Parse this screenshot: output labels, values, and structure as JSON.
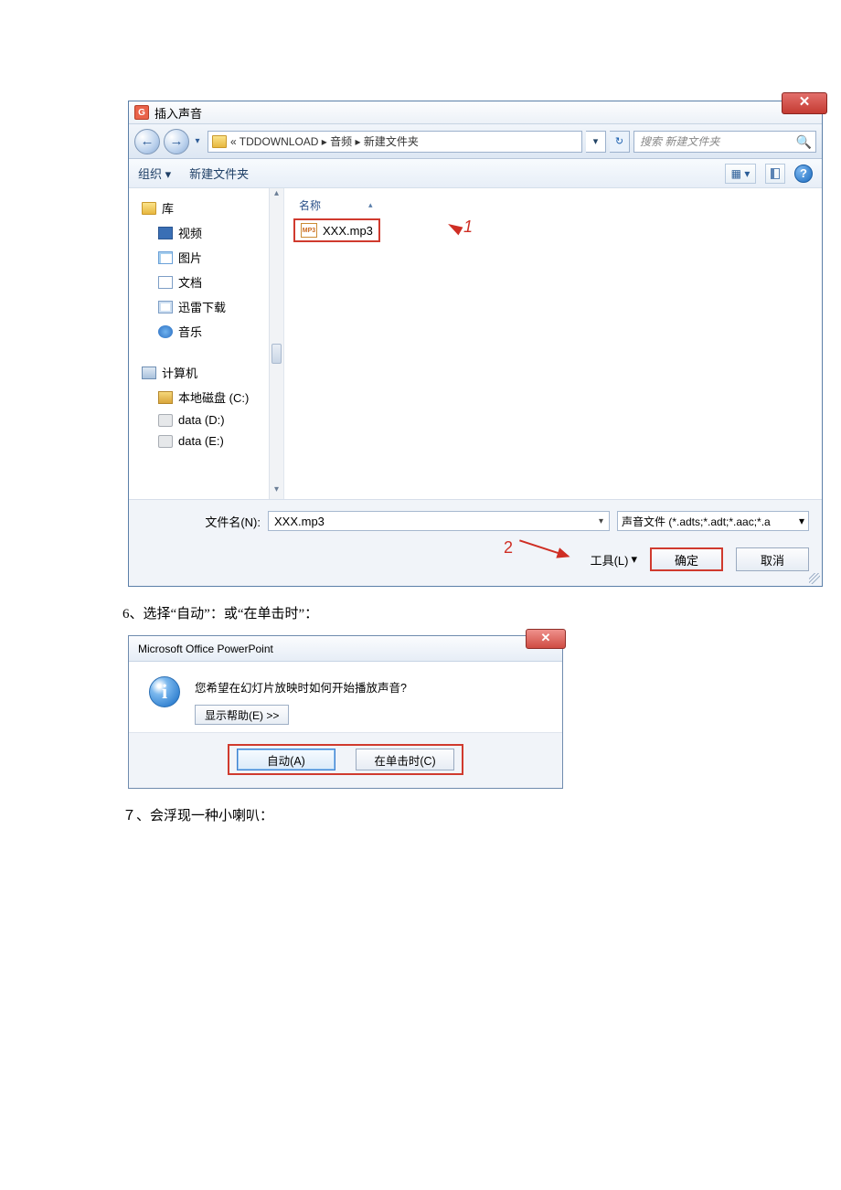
{
  "file_dialog": {
    "title": "插入声音",
    "breadcrumb": "«  TDDOWNLOAD  ▸  音频  ▸  新建文件夹",
    "search_placeholder": "搜索 新建文件夹",
    "toolbar": {
      "organize": "组织 ▾",
      "new_folder": "新建文件夹"
    },
    "tree": {
      "libraries": "库",
      "video": "视频",
      "pictures": "图片",
      "documents": "文档",
      "xunlei": "迅雷下载",
      "music": "音乐",
      "computer": "计算机",
      "drive_c": "本地磁盘 (C:)",
      "drive_d": "data (D:)",
      "drive_e": "data (E:)"
    },
    "list": {
      "header_name": "名称",
      "file1": "XXX.mp3"
    },
    "filename_label": "文件名(N):",
    "filename_value": "XXX.mp3",
    "filter": "声音文件 (*.adts;*.adt;*.aac;*.a",
    "tools": "工具(L)",
    "ok": "确定",
    "cancel": "取消",
    "annot1": "1",
    "annot2": "2"
  },
  "caption_6": "6、选择“自动”：或“在单击时”：",
  "msgbox": {
    "title": "Microsoft Office PowerPoint",
    "message": "您希望在幻灯片放映时如何开始播放声音?",
    "show_help": "显示帮助(E) >>",
    "auto": "自动(A)",
    "on_click": "在单击时(C)"
  },
  "caption_7": "７、会浮现一种小喇叭："
}
